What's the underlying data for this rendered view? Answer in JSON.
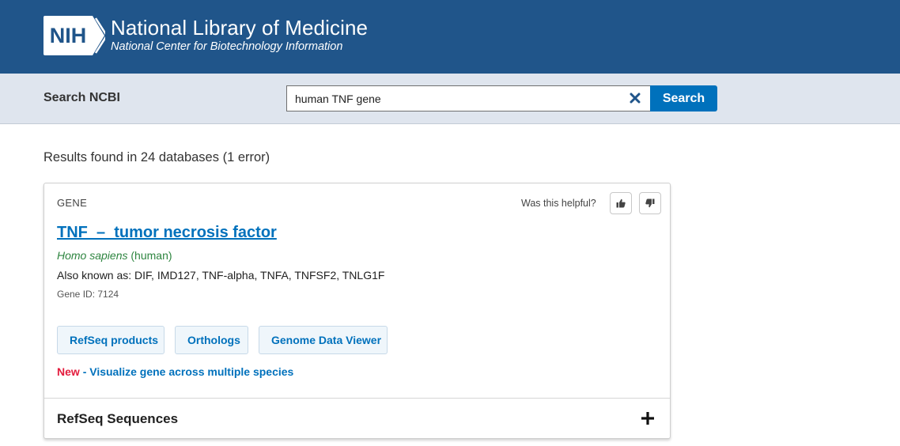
{
  "header": {
    "logo_text": "NIH",
    "title": "National Library of Medicine",
    "subtitle": "National Center for Biotechnology Information"
  },
  "search": {
    "label": "Search NCBI",
    "value": "human TNF gene",
    "button_label": "Search"
  },
  "results": {
    "summary": "Results found in 24 databases (1 error)"
  },
  "gene_card": {
    "db_label": "GENE",
    "helpful_text": "Was this helpful?",
    "title": "TNF  –  tumor necrosis factor",
    "organism_scientific": "Homo sapiens",
    "organism_common": "(human)",
    "aliases": "Also known as: DIF, IMD127, TNF-alpha, TNFA, TNFSF2, TNLG1F",
    "gene_id": "Gene ID: 7124",
    "buttons": [
      "RefSeq products",
      "Orthologs",
      "Genome Data Viewer"
    ],
    "new_badge": "New",
    "new_link": "- Visualize gene across multiple species",
    "refseq_heading": "RefSeq Sequences"
  },
  "colors": {
    "header_bg": "#20558a",
    "search_bar_bg": "#dfe5ee",
    "accent_blue": "#0071bc",
    "organism_green": "#2e8540",
    "new_red": "#e31c3d"
  },
  "icons": {
    "clear": "close-icon",
    "thumbs_up": "thumbs-up-icon",
    "thumbs_down": "thumbs-down-icon",
    "expand": "plus-icon"
  }
}
